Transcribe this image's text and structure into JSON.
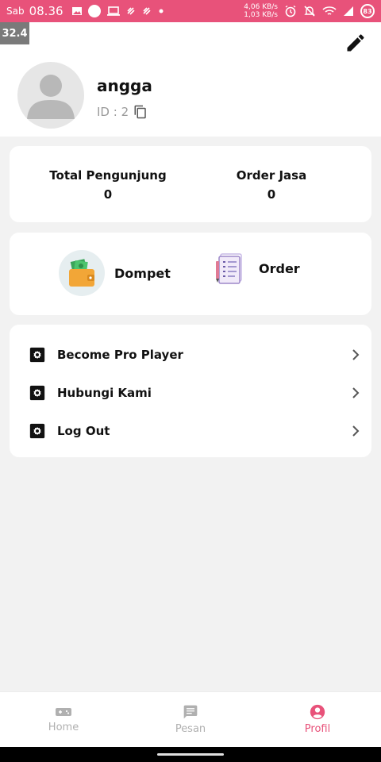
{
  "status_bar": {
    "day": "Sab",
    "time": "08.36",
    "speed_down": "4,06 KB/s",
    "speed_up": "1,03 KB/s",
    "battery": "83"
  },
  "overlay": {
    "fps": "32.4"
  },
  "profile": {
    "name": "angga",
    "id_label": "ID : 2"
  },
  "stats": {
    "visitors_label": "Total Pengunjung",
    "visitors_value": "0",
    "orders_label": "Order Jasa",
    "orders_value": "0"
  },
  "quick_actions": {
    "wallet_label": "Dompet",
    "order_label": "Order"
  },
  "menu": {
    "items": [
      {
        "label": "Become Pro Player"
      },
      {
        "label": "Hubungi Kami"
      },
      {
        "label": "Log Out"
      }
    ]
  },
  "bottom_nav": {
    "tabs": [
      {
        "label": "Home"
      },
      {
        "label": "Pesan"
      },
      {
        "label": "Profil"
      }
    ]
  },
  "colors": {
    "accent": "#e8527a",
    "inactive": "#b0b0b0"
  }
}
